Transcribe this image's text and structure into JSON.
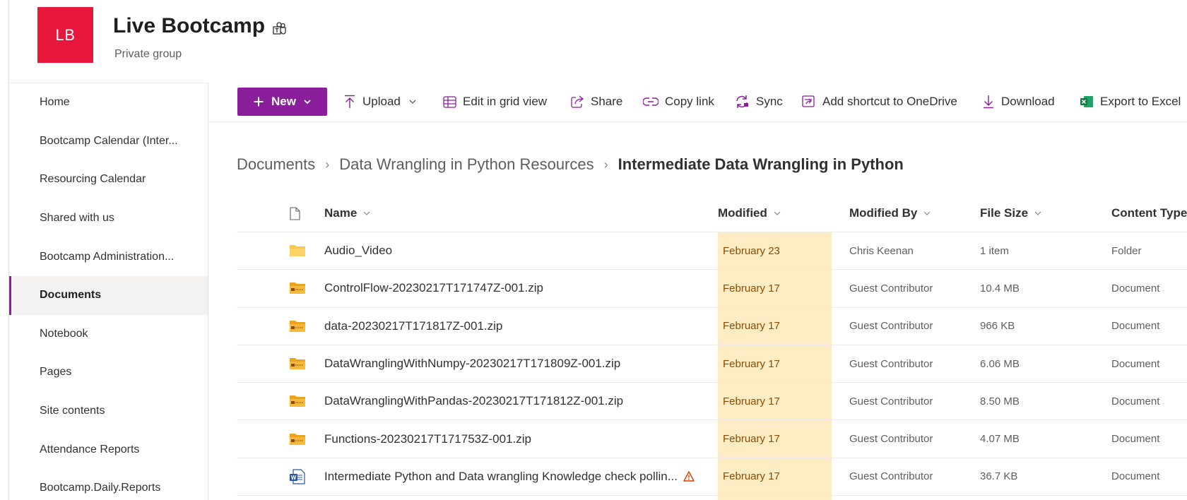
{
  "site": {
    "logo_initials": "LB",
    "title": "Live Bootcamp",
    "subtitle": "Private group",
    "logo_color": "#e8173c"
  },
  "nav": {
    "items": [
      {
        "label": "Home",
        "active": false
      },
      {
        "label": "Bootcamp Calendar (Inter...",
        "active": false
      },
      {
        "label": "Resourcing Calendar",
        "active": false
      },
      {
        "label": "Shared with us",
        "active": false
      },
      {
        "label": "Bootcamp Administration...",
        "active": false
      },
      {
        "label": "Documents",
        "active": true
      },
      {
        "label": "Notebook",
        "active": false
      },
      {
        "label": "Pages",
        "active": false
      },
      {
        "label": "Site contents",
        "active": false
      },
      {
        "label": "Attendance Reports",
        "active": false
      },
      {
        "label": "Bootcamp.Daily.Reports",
        "active": false
      }
    ]
  },
  "commandbar": {
    "new_label": "New",
    "upload_label": "Upload",
    "grid_label": "Edit in grid view",
    "share_label": "Share",
    "copylink_label": "Copy link",
    "sync_label": "Sync",
    "shortcut_label": "Add shortcut to OneDrive",
    "download_label": "Download",
    "export_label": "Export to Excel",
    "accent_color": "#8a1e9b"
  },
  "breadcrumb": {
    "items": [
      "Documents",
      "Data Wrangling in Python Resources"
    ],
    "current": "Intermediate Data Wrangling in Python"
  },
  "table": {
    "columns": {
      "name": "Name",
      "modified": "Modified",
      "modified_by": "Modified By",
      "file_size": "File Size",
      "content_type": "Content Type"
    },
    "rows": [
      {
        "icon": "folder-icon",
        "name": "Audio_Video",
        "modified": "February 23",
        "modified_by": "Chris Keenan",
        "size": "1 item",
        "type": "Folder"
      },
      {
        "icon": "zip-icon",
        "name": "ControlFlow-20230217T171747Z-001.zip",
        "modified": "February 17",
        "modified_by": "Guest Contributor",
        "size": "10.4 MB",
        "type": "Document"
      },
      {
        "icon": "zip-icon",
        "name": "data-20230217T171817Z-001.zip",
        "modified": "February 17",
        "modified_by": "Guest Contributor",
        "size": "966 KB",
        "type": "Document"
      },
      {
        "icon": "zip-icon",
        "name": "DataWranglingWithNumpy-20230217T171809Z-001.zip",
        "modified": "February 17",
        "modified_by": "Guest Contributor",
        "size": "6.06 MB",
        "type": "Document"
      },
      {
        "icon": "zip-icon",
        "name": "DataWranglingWithPandas-20230217T171812Z-001.zip",
        "modified": "February 17",
        "modified_by": "Guest Contributor",
        "size": "8.50 MB",
        "type": "Document"
      },
      {
        "icon": "zip-icon",
        "name": "Functions-20230217T171753Z-001.zip",
        "modified": "February 17",
        "modified_by": "Guest Contributor",
        "size": "4.07 MB",
        "type": "Document"
      },
      {
        "icon": "word-icon",
        "name": "Intermediate Python and Data wrangling Knowledge check pollin...",
        "modified": "February 17",
        "modified_by": "Guest Contributor",
        "size": "36.7 KB",
        "type": "Document",
        "warning": true
      }
    ],
    "highlight_color": "#fdecc4"
  }
}
